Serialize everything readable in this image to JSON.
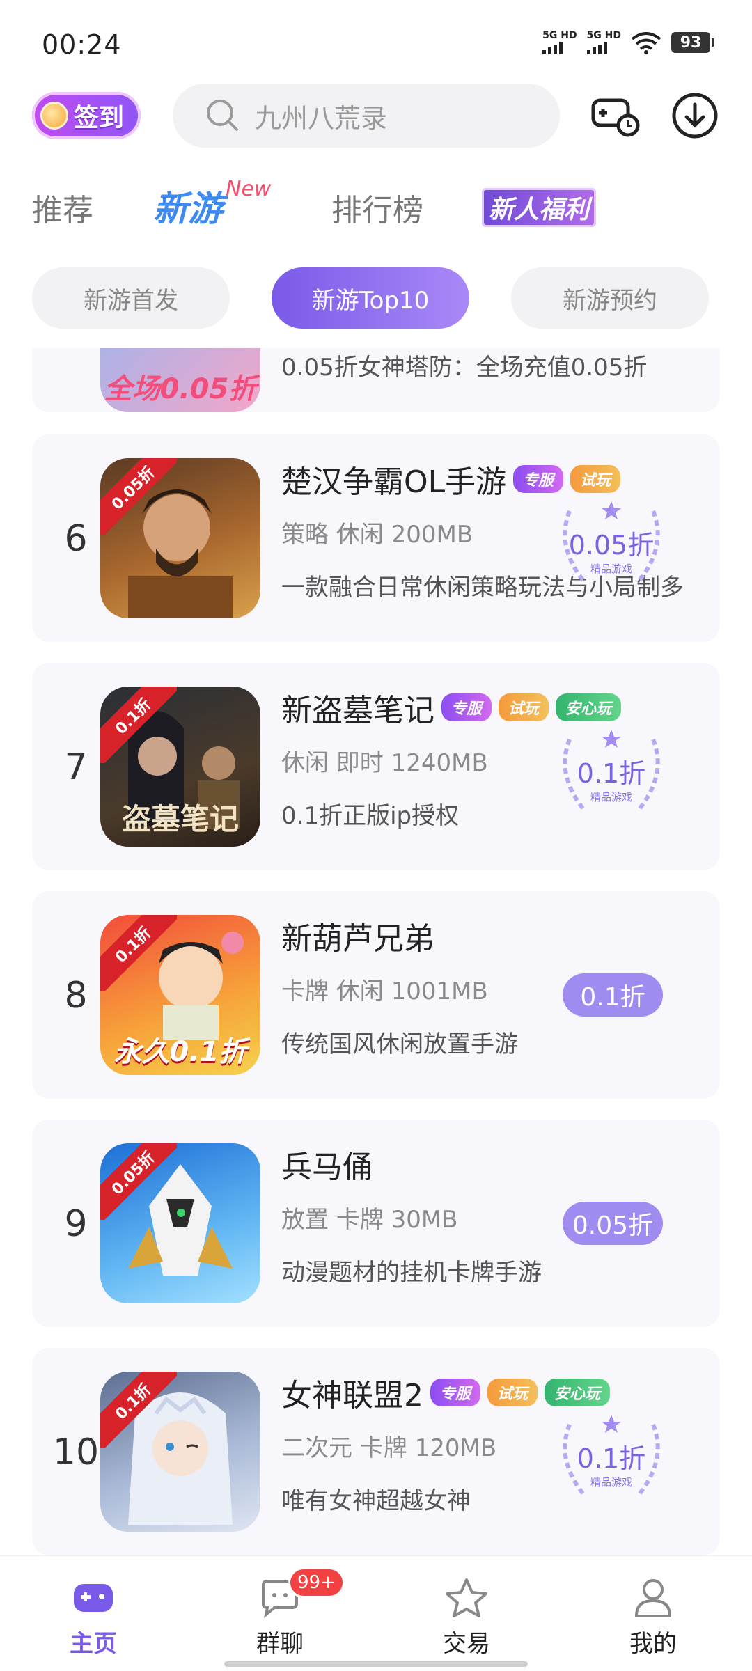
{
  "status_bar": {
    "time": "00:24",
    "signal1": "5G HD",
    "signal2": "5G HD",
    "battery": "93"
  },
  "header": {
    "checkin_label": "签到",
    "search_placeholder": "九州八荒录"
  },
  "main_tabs": [
    {
      "label": "推荐",
      "badge": ""
    },
    {
      "label": "新游",
      "badge": "New"
    },
    {
      "label": "排行榜",
      "badge": ""
    },
    {
      "label": "新人福利",
      "badge": ""
    }
  ],
  "sub_tabs": [
    {
      "label": "新游首发"
    },
    {
      "label": "新游Top10"
    },
    {
      "label": "新游预约"
    }
  ],
  "partial_item": {
    "desc": "0.05折女神塔防：全场充值0.05折",
    "icon_text": "全场0.05折"
  },
  "games": [
    {
      "rank": "6",
      "name": "楚汉争霸OL手游",
      "tags": [
        "专服",
        "试玩"
      ],
      "meta": "策略 休闲 200MB",
      "desc": "一款融合日常休闲策略玩法与小局制多",
      "discount": "0.05折",
      "discount_caption": "精品游戏",
      "corner": "0.05折"
    },
    {
      "rank": "7",
      "name": "新盗墓笔记",
      "tags": [
        "专服",
        "试玩",
        "安心玩"
      ],
      "meta": "休闲 即时 1240MB",
      "desc": "0.1折正版ip授权",
      "discount": "0.1折",
      "discount_caption": "精品游戏",
      "corner": "0.1折",
      "icon_title": "盗墓笔记"
    },
    {
      "rank": "8",
      "name": "新葫芦兄弟",
      "tags": [],
      "meta": "卡牌 休闲 1001MB",
      "desc": "传统国风休闲放置手游",
      "discount": "0.1折",
      "corner": "0.1折",
      "icon_title": "永久0.1折"
    },
    {
      "rank": "9",
      "name": "兵马俑",
      "tags": [],
      "meta": "放置 卡牌 30MB",
      "desc": "动漫题材的挂机卡牌手游",
      "discount": "0.05折",
      "corner": "0.05折"
    },
    {
      "rank": "10",
      "name": "女神联盟2",
      "tags": [
        "专服",
        "试玩",
        "安心玩"
      ],
      "meta": "二次元 卡牌 120MB",
      "desc": "唯有女神超越女神",
      "discount": "0.1折",
      "discount_caption": "精品游戏",
      "corner": "0.1折"
    }
  ],
  "bottom_nav": [
    {
      "label": "主页",
      "icon": "gamepad-icon",
      "active": true
    },
    {
      "label": "群聊",
      "icon": "chat-icon",
      "badge": "99+"
    },
    {
      "label": "交易",
      "icon": "star-icon"
    },
    {
      "label": "我的",
      "icon": "user-icon"
    }
  ],
  "colors": {
    "accent": "#7a5ae8",
    "discount_pill": "#a08cf0",
    "badge": "#f24141"
  }
}
